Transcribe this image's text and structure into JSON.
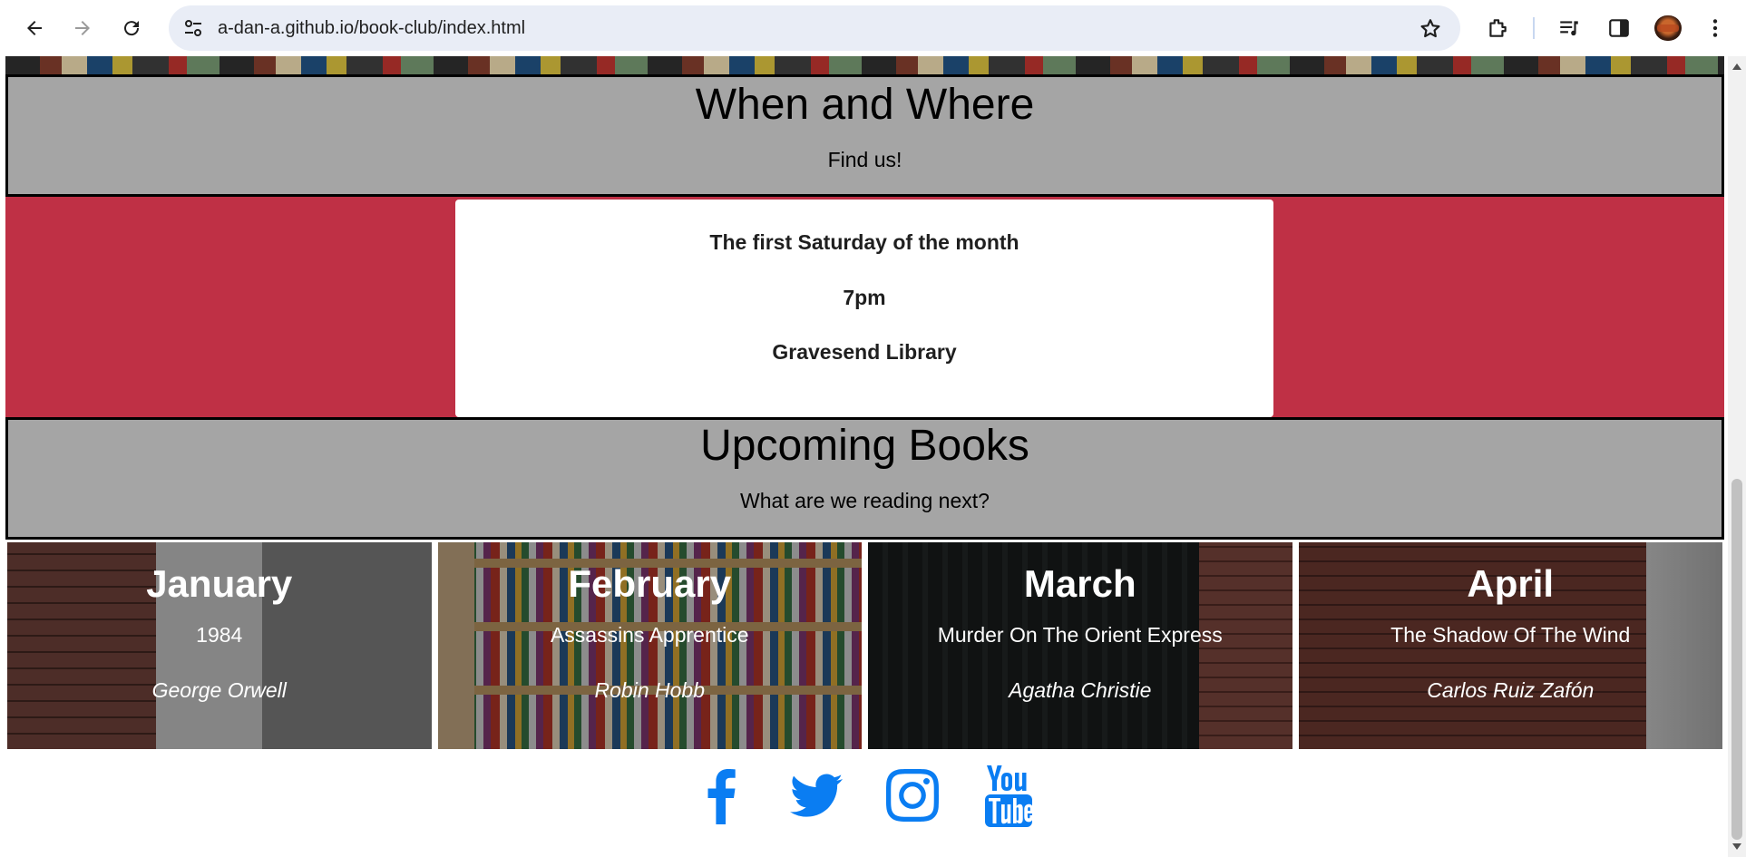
{
  "browser": {
    "url": "a-dan-a.github.io/book-club/index.html",
    "icons": [
      "back-icon",
      "forward-icon",
      "reload-icon",
      "site-info-icon",
      "bookmark-star-icon",
      "extensions-icon",
      "media-controls-icon",
      "side-panel-icon",
      "profile-avatar",
      "more-menu-icon"
    ]
  },
  "when_where": {
    "heading": "When and Where",
    "subheading": "Find us!",
    "details": [
      "The first Saturday of the month",
      "7pm",
      "Gravesend Library"
    ]
  },
  "upcoming": {
    "heading": "Upcoming Books",
    "subheading": "What are we reading next?",
    "books": [
      {
        "month": "January",
        "title": "1984",
        "author": "George Orwell"
      },
      {
        "month": "February",
        "title": "Assassins Apprentice",
        "author": "Robin Hobb"
      },
      {
        "month": "March",
        "title": "Murder On The Orient Express",
        "author": "Agatha Christie"
      },
      {
        "month": "April",
        "title": "The Shadow Of The Wind",
        "author": "Carlos Ruiz Zafón"
      }
    ]
  },
  "social": {
    "icons": [
      "facebook-icon",
      "twitter-icon",
      "instagram-icon",
      "youtube-icon"
    ]
  },
  "colors": {
    "band_grey": "#a5a5a5",
    "accent_red": "#bf3045",
    "social_blue": "#0a7df2"
  }
}
